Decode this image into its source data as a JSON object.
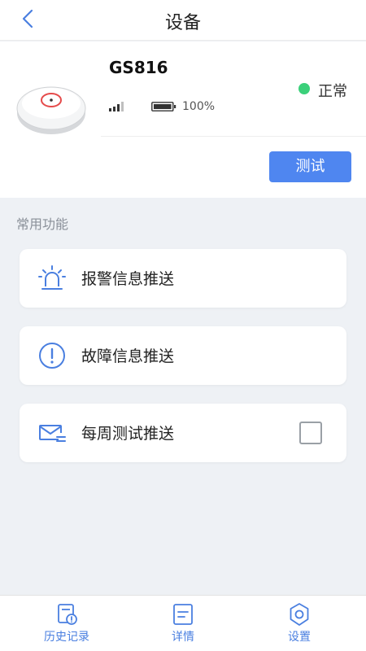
{
  "header": {
    "title": "设备"
  },
  "device": {
    "name": "GS816",
    "battery": "100%",
    "status": "正常",
    "test_button": "测试"
  },
  "section": {
    "label": "常用功能"
  },
  "functions": [
    {
      "label": "报警信息推送",
      "icon": "alarm-light-icon"
    },
    {
      "label": "故障信息推送",
      "icon": "exclamation-circle-icon"
    },
    {
      "label": "每周测试推送",
      "icon": "envelope-icon"
    }
  ],
  "tabs": [
    {
      "label": "历史记录",
      "icon": "history-record-icon"
    },
    {
      "label": "详情",
      "icon": "details-icon"
    },
    {
      "label": "设置",
      "icon": "gear-icon"
    }
  ],
  "colors": {
    "accent": "#4f86f0",
    "status_ok": "#3bd07a",
    "background": "#eef1f5"
  }
}
